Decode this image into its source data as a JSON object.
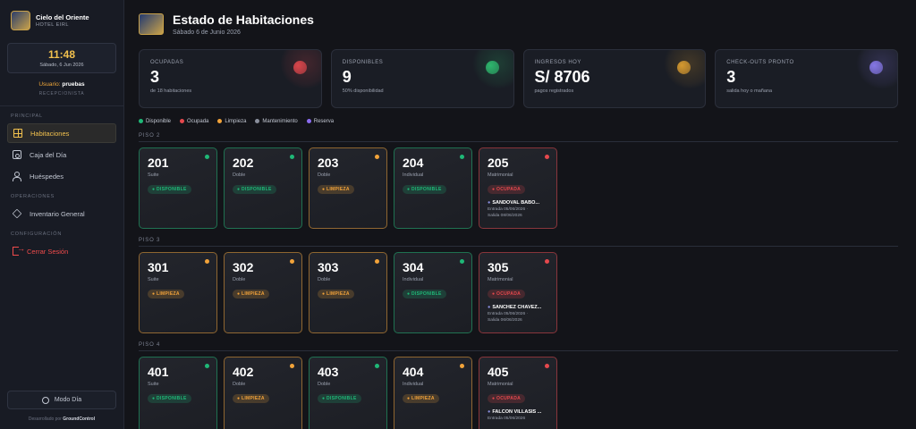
{
  "sidebar": {
    "brand_name": "Cielo del Oriente",
    "brand_sub": "HOTEL EIRL",
    "clock_time": "11:48",
    "clock_date": "Sábado, 6 Jun 2026",
    "user_label": "Usuario:",
    "user_name": "pruebas",
    "user_role": "RECEPCIONISTA",
    "sections": {
      "principal": "PRINCIPAL",
      "operaciones": "OPERACIONES",
      "configuracion": "CONFIGURACIÓN"
    },
    "nav": {
      "habitaciones": "Habitaciones",
      "caja": "Caja del Día",
      "huespedes": "Huéspedes",
      "inventario": "Inventario General",
      "cerrar": "Cerrar Sesión"
    },
    "mode_button": "Modo Día",
    "footer_prefix": "Desarrollado por",
    "footer_brand": "GroundControl"
  },
  "header": {
    "title": "Estado de Habitaciones",
    "date": "Sábado 6 de Junio 2026"
  },
  "stats": [
    {
      "label": "OCUPADAS",
      "value": "3",
      "sub": "de 18 habitaciones",
      "color": "#e5484d"
    },
    {
      "label": "DISPONIBLES",
      "value": "9",
      "sub": "50% disponibilidad",
      "color": "#2fbf71"
    },
    {
      "label": "INGRESOS HOY",
      "value": "S/ 8706",
      "sub": "pagos registrados",
      "color": "#e0a030"
    },
    {
      "label": "CHECK-OUTS PRONTO",
      "value": "3",
      "sub": "salida hoy o mañana",
      "color": "#8b7cf0"
    }
  ],
  "legend": {
    "disponible": "Disponible",
    "ocupada": "Ocupada",
    "limpieza": "Limpieza",
    "mantenimiento": "Mantenimiento",
    "reserva": "Reserva"
  },
  "status_colors": {
    "disponible": "#1fb877",
    "ocupada": "#e5484d",
    "limpieza": "#f2a33a",
    "mantenimiento": "#8a8f9c",
    "reserva": "#8b6cf0"
  },
  "floors": [
    {
      "label": "PISO 2",
      "rooms": [
        {
          "num": "201",
          "type": "Suite",
          "status": "DISPONIBLE"
        },
        {
          "num": "202",
          "type": "Doble",
          "status": "DISPONIBLE"
        },
        {
          "num": "203",
          "type": "Doble",
          "status": "LIMPIEZA"
        },
        {
          "num": "204",
          "type": "Individual",
          "status": "DISPONIBLE"
        },
        {
          "num": "205",
          "type": "Matrimonial",
          "status": "OCUPADA",
          "guest": "SANDOVAL BABO...",
          "entrada": "Entrada 05/06/2026 ·",
          "salida": "Salida 08/06/2026"
        }
      ]
    },
    {
      "label": "PISO 3",
      "rooms": [
        {
          "num": "301",
          "type": "Suite",
          "status": "LIMPIEZA"
        },
        {
          "num": "302",
          "type": "Doble",
          "status": "LIMPIEZA"
        },
        {
          "num": "303",
          "type": "Doble",
          "status": "LIMPIEZA"
        },
        {
          "num": "304",
          "type": "Individual",
          "status": "DISPONIBLE"
        },
        {
          "num": "305",
          "type": "Matrimonial",
          "status": "OCUPADA",
          "guest": "SANCHEZ CHAVEZ...",
          "entrada": "Entrada 05/06/2026 ·",
          "salida": "Salida 06/06/2026"
        }
      ]
    },
    {
      "label": "PISO 4",
      "rooms": [
        {
          "num": "401",
          "type": "Suite",
          "status": "DISPONIBLE"
        },
        {
          "num": "402",
          "type": "Doble",
          "status": "LIMPIEZA"
        },
        {
          "num": "403",
          "type": "Doble",
          "status": "DISPONIBLE"
        },
        {
          "num": "404",
          "type": "Individual",
          "status": "LIMPIEZA"
        },
        {
          "num": "405",
          "type": "Matrimonial",
          "status": "OCUPADA",
          "guest": "FALCON VILLASIS ...",
          "entrada": "Entrada 05/06/2026",
          "salida": ""
        }
      ]
    }
  ]
}
